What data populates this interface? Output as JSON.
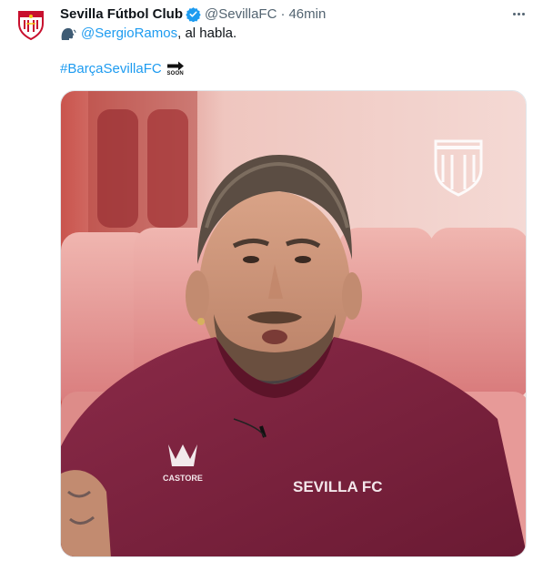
{
  "tweet": {
    "display_name": "Sevilla Fútbol Club",
    "handle": "@SevillaFC",
    "separator": "·",
    "time": "46min",
    "body": {
      "mention": "@SergioRamos",
      "text_after": ", al habla.",
      "hashtag": "#BarçaSevillaFC",
      "soon_emoji_text": "SOON"
    },
    "media_overlay": {
      "shirt_brand": "CASTORE",
      "shirt_club": "SEVILLA FC"
    }
  },
  "colors": {
    "link": "#1d9bf0",
    "verified": "#1d9bf0",
    "secondary_text": "#536471",
    "jersey": "#7a2140",
    "background_wall": "#f2d6d1"
  },
  "icons": {
    "avatar": "sevilla-crest-icon",
    "verified": "verified-badge-icon",
    "speaking": "speaking-head-icon",
    "soon": "soon-arrow-icon",
    "more": "more-options-icon"
  }
}
